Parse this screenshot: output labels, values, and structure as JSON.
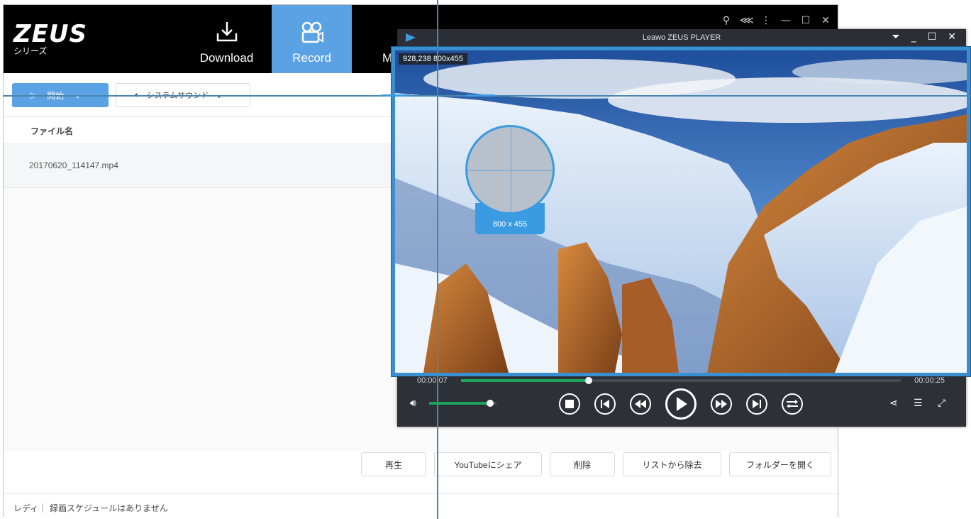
{
  "app": {
    "logo_main": "ZEUS",
    "logo_sub": "シリーズ",
    "tabs": [
      {
        "label": "Download"
      },
      {
        "label": "Record"
      },
      {
        "label": "M"
      }
    ]
  },
  "toolbar": {
    "start_label": "開始",
    "audio_label": "システムサウンド"
  },
  "list": {
    "column_filename": "ファイル名",
    "rows": [
      {
        "filename": "20170620_114147.mp4"
      }
    ]
  },
  "actions": {
    "play": "再生",
    "share_youtube": "YouTubeにシェア",
    "delete": "削除",
    "remove_from_list": "リストから除去",
    "open_folder": "フォルダーを開く"
  },
  "status": {
    "text": "レディ｜ 録画スケジュールはありません"
  },
  "player": {
    "title": "Leawo ZEUS PLAYER",
    "coord_readout": "928,238 800x455",
    "magnifier_size": "800 x 455",
    "time_current": "00:00:07",
    "time_total": "00:00:25",
    "progress_fraction": 0.29,
    "volume_fraction": 0.9
  },
  "colors": {
    "accent": "#5aa2e4",
    "progress": "#1aa55a",
    "frame": "#3a8fd0"
  },
  "icons": {
    "download": "download-icon",
    "record": "camera-icon",
    "search": "search-icon",
    "share": "share-icon",
    "menu": "more-icon",
    "minimize": "minimize-icon",
    "maximize": "maximize-icon",
    "close": "close-icon"
  }
}
